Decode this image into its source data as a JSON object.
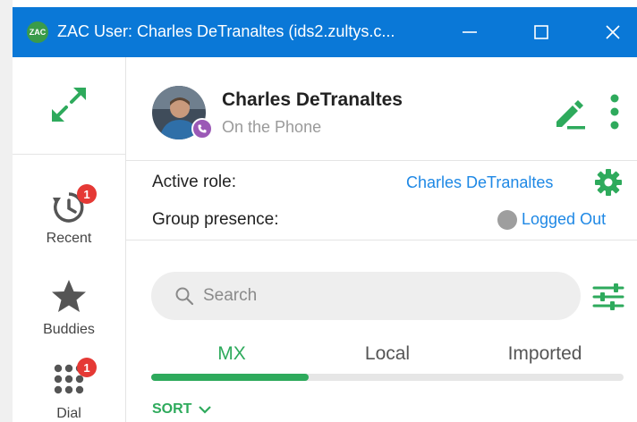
{
  "window": {
    "title": "ZAC User: Charles DeTranaltes (ids2.zultys.c...",
    "logo_text": "ZAC"
  },
  "rail": {
    "items": [
      {
        "label": "Recent",
        "badge": "1",
        "icon": "history-icon"
      },
      {
        "label": "Buddies",
        "icon": "star-icon"
      },
      {
        "label": "Dial",
        "badge": "1",
        "icon": "dialpad-icon"
      }
    ]
  },
  "profile": {
    "name": "Charles DeTranaltes",
    "status": "On the Phone"
  },
  "role": {
    "label": "Active role:",
    "value": "Charles DeTranaltes"
  },
  "presence": {
    "label": "Group presence:",
    "value": "Logged Out"
  },
  "search": {
    "placeholder": "Search"
  },
  "tabs": [
    {
      "label": "MX",
      "active": true
    },
    {
      "label": "Local",
      "active": false
    },
    {
      "label": "Imported",
      "active": false
    }
  ],
  "sort": {
    "label": "SORT"
  },
  "colors": {
    "titlebar": "#0a78d7",
    "accent_green": "#2eaa5c",
    "link_blue": "#1e88e5",
    "badge_red": "#e53935",
    "phone_purple": "#9b59b6"
  }
}
